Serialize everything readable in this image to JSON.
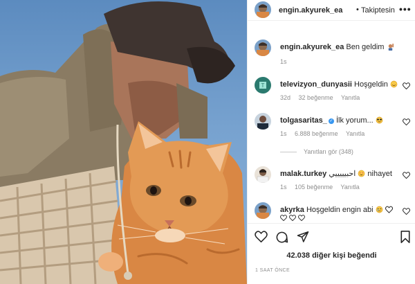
{
  "post": {
    "author": "engin.akyurek_ea",
    "separator": "•",
    "follow_status": "Takiptesin",
    "more": "•••",
    "caption": "Ben geldim"
  },
  "comments": [
    {
      "user": "televizyon_dunyasii",
      "text": "Hoşgeldin",
      "age": "32d",
      "likes": "32 beğenme",
      "reply": "Yanıtla"
    },
    {
      "user": "tolgasaritas_",
      "text": "İlk yorum...",
      "age": "1s",
      "likes": "6.888 beğenme",
      "reply": "Yanıtla",
      "view_replies": "Yanıtları gör (348)"
    },
    {
      "user": "malak.turkey",
      "text": "احبيييييي",
      "text2": "nihayet",
      "age": "1s",
      "likes": "105 beğenme",
      "reply": "Yanıtla"
    },
    {
      "user": "akyrka",
      "text": "Hoşgeldin engin abi"
    }
  ],
  "caption_age": "1s",
  "likes_summary": "42.038 diğer kişi beğendi",
  "timestamp": "1 SAAT ÖNCE",
  "icons": [
    "heart-icon",
    "comment-icon",
    "share-icon",
    "bookmark-icon"
  ]
}
